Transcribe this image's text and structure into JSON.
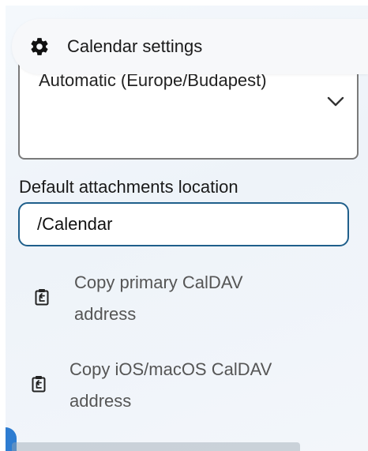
{
  "header": {
    "title": "Calendar settings",
    "icon": "gear-icon"
  },
  "timezone": {
    "value": "Automatic (Europe/Budapest)",
    "icon": "chevron-down-icon"
  },
  "attachments": {
    "label": "Default attachments location",
    "value": "/Calendar"
  },
  "actions": [
    {
      "line1": "Copy primary CalDAV",
      "line2": "address",
      "icon": "clipboard-icon"
    },
    {
      "line1": "Copy iOS/macOS CalDAV",
      "line2": "address",
      "icon": "clipboard-icon"
    }
  ],
  "colors": {
    "accent": "#1f5f8b",
    "brand_blue": "#2d7cd1",
    "text": "#1a1a1a",
    "muted_text": "#555555"
  }
}
